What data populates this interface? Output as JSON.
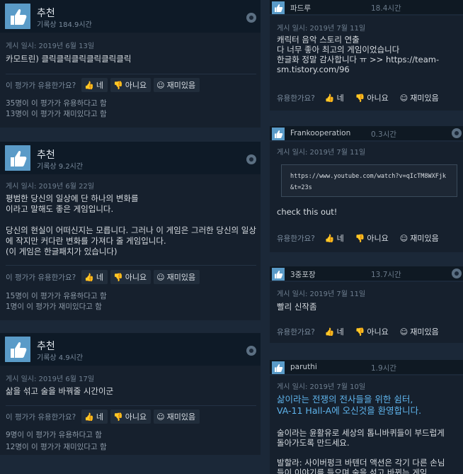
{
  "vote": {
    "question": "이 평가가 유용한가요?",
    "yes": "네",
    "no": "아니요",
    "funny": "재미있음"
  },
  "reviews": [
    {
      "title": "추천",
      "hours": "기록상 184.9시간",
      "posted": "게시 일시: 2019년 6월 13일",
      "body": "카모트린) 클릭클릭클릭클릭클릭클릭",
      "helpful": "35명이 이 평가가 유용하다고 함",
      "funny": "13명이 이 평가가 재미있다고 함"
    },
    {
      "title": "추천",
      "hours": "기록상 9.2시간",
      "posted": "게시 일시: 2019년 6월 22일",
      "body": "평범한 당신의 일상에 단 하나의 변화를\n이라고 말해도 좋은 게임입니다.\n\n당신의 현실이 어떠신지는 모릅니다. 그러나 이 게임은 그러한 당신의 일상에 작지만 커다란 변화를 가져다 줄 게임입니다.\n(이 게임은 한글패치가 있습니다)",
      "helpful": "15명이 이 평가가 유용하다고 함",
      "funny": "1명이 이 평가가 재미있다고 함"
    },
    {
      "title": "추천",
      "hours": "기록상 4.9시간",
      "posted": "게시 일시: 2019년 6월 17일",
      "body": "삶을 섞고 술을 바꿔줄 시간이군",
      "helpful": "9명이 이 평가가 유용하다고 함",
      "funny": "12명이 이 평가가 재미있다고 함"
    }
  ],
  "comments": [
    {
      "name": "파드루",
      "hours": "18.4시간",
      "posted": "게시 일시: 2019년 7월 11일",
      "text": "캐릭터 음악 스토리 연출\n다 너무 좋아 최고의 게임이었습니다\n한글화 정말 감사합니다 ㅠ >> ",
      "link": "https://team-sm.tistory.com/96",
      "vote_q": "유용한가요?"
    },
    {
      "name": "Frankooperation",
      "hours": "0.3시간",
      "posted": "게시 일시: 2019년 7월 11일",
      "code": "https://www.youtube.com/watch?v=qIcTM8WXFjk&t=23s",
      "text": "check this out!",
      "vote_q": "유용한가요?"
    },
    {
      "name": "3중포장",
      "hours": "13.7시간",
      "posted": "게시 일시: 2019년 7월 11일",
      "text": "빨리 신작좀",
      "vote_q": "유용한가요?"
    },
    {
      "name": "paruthi",
      "hours": "1.9시간",
      "posted": "게시 일시: 2019년 7월 10일",
      "heading": "삶이라는 전쟁의 전사들을 위한 쉼터,\nVA-11 Hall-A에 오신것을 환영합니다.",
      "text": "술이라는 윤활유로 세상의 톱니바퀴들이 부드럽게\n돌아가도록 만드세요.\n\n발할라: 사이버펑크 바텐더 액션은 각기 다른 손님\n들이 이야기를 들으며 술을 섞고 바뀌는 게임"
    }
  ]
}
